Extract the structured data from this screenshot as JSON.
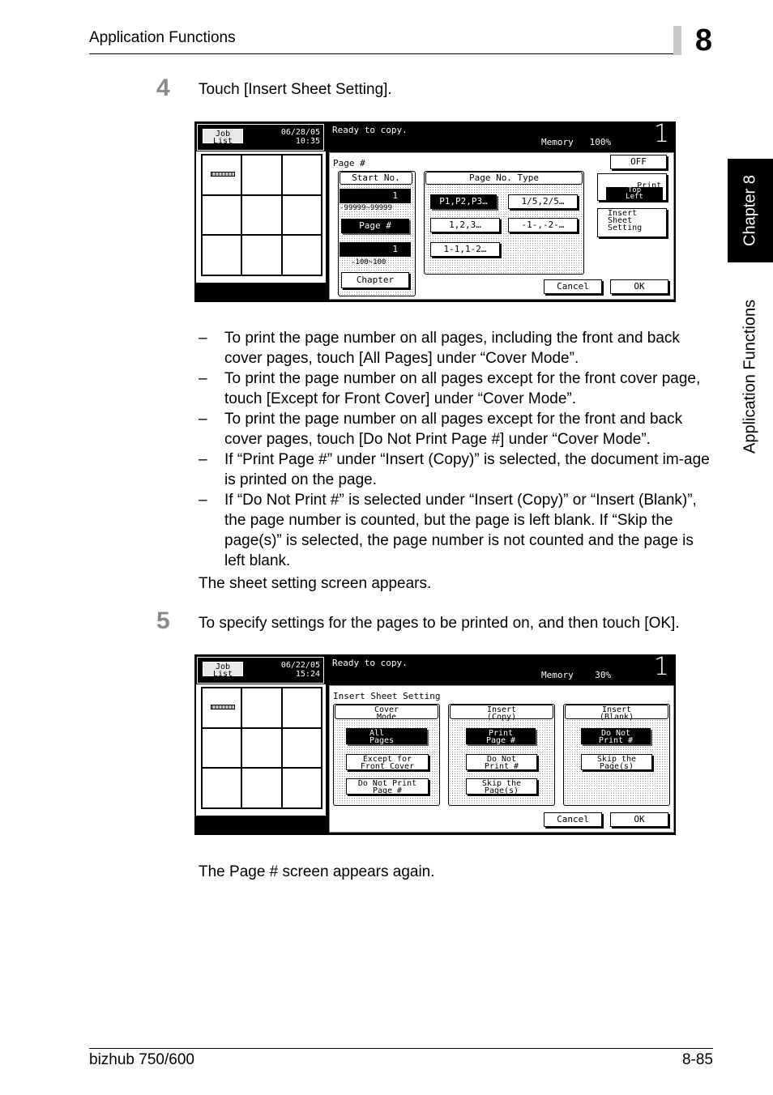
{
  "header": {
    "title": "Application Functions",
    "chapter_number": "8"
  },
  "side_tab": {
    "chapter": "Chapter 8",
    "section": "Application Functions"
  },
  "step4": {
    "number": "4",
    "text": "Touch [Insert Sheet Setting]."
  },
  "screen1": {
    "job_list": "Job\nList",
    "date": "06/28/05",
    "time": "10:35",
    "status": "Ready to copy.",
    "memory_label": "Memory",
    "memory_value": "100%",
    "copies": "1",
    "page_title": "Page #",
    "start_no_label": "Start No.",
    "start_value": "1",
    "start_range": "-99999~99999",
    "page_button": "Page #",
    "chapter_value": "1",
    "chapter_range": "-100~100",
    "chapter_button": "Chapter",
    "type_label": "Page No. Type",
    "types": [
      "P1,P2,P3…",
      "1/5,2/5…",
      "1,2,3…",
      "-1-,-2-…",
      "1-1,1-2…"
    ],
    "off": "OFF",
    "print_position": "Print\nPosition",
    "position_value": "Top\nLeft",
    "insert_sheet": "Insert\nSheet\nSetting",
    "cancel": "Cancel",
    "ok": "OK"
  },
  "bullets": [
    "To print the page number on all pages, including the front and back cover pages, touch [All Pages] under “Cover Mode”.",
    "To print the page number on all pages except for the front cover page, touch [Except for Front Cover] under “Cover Mode”.",
    "To print the page number on all pages except for the front and back cover pages, touch [Do Not Print Page #] under “Cover Mode”.",
    "If “Print Page #” under “Insert (Copy)” is selected, the document im-age is printed on the page.",
    "If “Do Not Print #” is selected under “Insert (Copy)” or “Insert (Blank)”, the page number is counted, but the page is left blank. If “Skip the page(s)” is selected, the page number is not counted and the page is left blank."
  ],
  "sheet_screen_text": "The sheet setting screen appears.",
  "step5": {
    "number": "5",
    "text": "To specify settings for the pages to be printed on, and then touch [OK]."
  },
  "screen2": {
    "job_list": "Job\nList",
    "date": "06/22/05",
    "time": "15:24",
    "status": "Ready to copy.",
    "memory_label": "Memory",
    "memory_value": "30%",
    "copies": "1",
    "title": "Insert Sheet Setting",
    "cover_mode": "Cover\nMode",
    "insert_copy": "Insert\n(Copy)",
    "insert_blank": "Insert\n(Blank)",
    "all_pages": "All\nPages",
    "except_front": "Except for\nFront Cover",
    "do_not_print_page": "Do Not Print\nPage #",
    "print_page": "Print\nPage #",
    "do_not_print": "Do Not\nPrint #",
    "skip_pages": "Skip the\nPage(s)",
    "blank_do_not_print": "Do Not\nPrint #",
    "blank_skip": "Skip the\nPage(s)",
    "cancel": "Cancel",
    "ok": "OK"
  },
  "page_again_text": "The Page # screen appears again.",
  "footer": {
    "model": "bizhub 750/600",
    "page": "8-85"
  }
}
